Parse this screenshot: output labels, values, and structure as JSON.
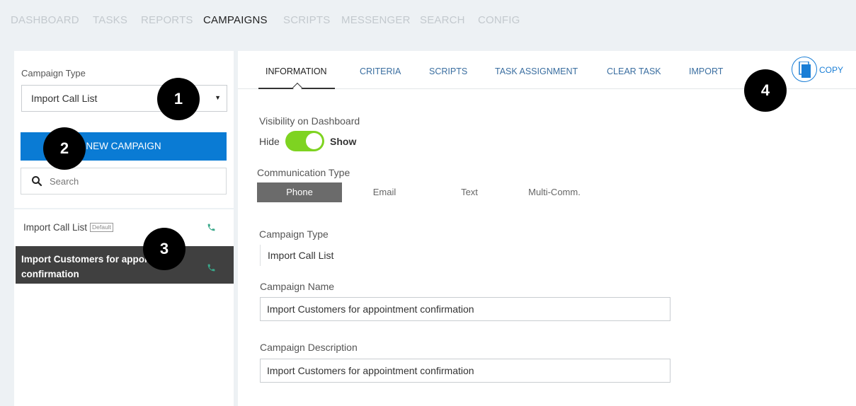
{
  "nav": {
    "items": [
      "DASHBOARD",
      "TASKS",
      "REPORTS",
      "CAMPAIGNS",
      "SCRIPTS",
      "MESSENGER",
      "SEARCH",
      "CONFIG"
    ],
    "active": "CAMPAIGNS"
  },
  "sidebar": {
    "campaign_type_label": "Campaign Type",
    "campaign_type_value": "Import Call List",
    "new_campaign_label": "NEW CAMPAIGN",
    "search_placeholder": "Search",
    "campaigns": [
      {
        "name": "Import Call List",
        "badge": "Default",
        "icon": "phone-icon",
        "selected": false
      },
      {
        "name": "Import Customers for appointment confirmation",
        "icon": "phone-icon",
        "selected": true
      }
    ]
  },
  "tabs": {
    "items": [
      "INFORMATION",
      "CRITERIA",
      "SCRIPTS",
      "TASK ASSIGNMENT",
      "CLEAR TASK",
      "IMPORT"
    ],
    "active": "INFORMATION",
    "copy_label": "COPY",
    "copy_icon": "copy-icon"
  },
  "form": {
    "visibility_label": "Visibility on Dashboard",
    "toggle_off_label": "Hide",
    "toggle_on_label": "Show",
    "toggle_state": "on",
    "communication_label": "Communication Type",
    "communication_options": [
      "Phone",
      "Email",
      "Text",
      "Multi-Comm."
    ],
    "communication_selected": "Phone",
    "campaign_type_label": "Campaign Type",
    "campaign_type_value": "Import Call List",
    "campaign_name_label": "Campaign Name",
    "campaign_name_value": "Import Customers for appointment confirmation",
    "campaign_description_label": "Campaign Description",
    "campaign_description_value": "Import Customers for appointment confirmation"
  },
  "callouts": [
    "1",
    "2",
    "3",
    "4"
  ],
  "colors": {
    "primary_blue": "#0a7bd4",
    "toggle_green": "#7ed321",
    "selected_row": "#404040",
    "phone_icon": "#3aa88a"
  }
}
